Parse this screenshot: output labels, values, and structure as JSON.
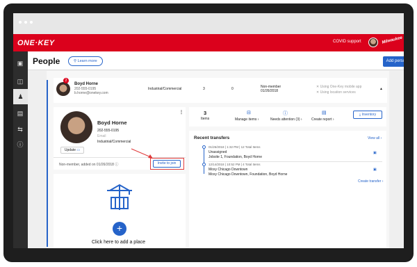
{
  "app": {
    "logo": "ONE·KEY",
    "covid_support": "COVID support",
    "brand": "Milwaukee"
  },
  "sidebar": {
    "icons": [
      "toolbox-icon",
      "map-icon",
      "person-icon",
      "report-icon",
      "transfer-icon",
      "alert-icon"
    ]
  },
  "header": {
    "title": "People",
    "learn_more": "Learn more",
    "add_person": "Add person"
  },
  "person_row": {
    "badge": "2",
    "name": "Boyd Horne",
    "phone": "202-555-0195",
    "email": "b.horne@onekey.com",
    "trade": "Industrial/Commercial",
    "count1": "3",
    "count2": "0",
    "status": "Non-member",
    "status_date": "01/26/2018",
    "app_note": "Using One-Key mobile app",
    "location_note": "Using location services"
  },
  "profile": {
    "name": "Boyd Horne",
    "phone": "202-555-0195",
    "email_placeholder": "Email",
    "trade": "Industrial/Commercial",
    "update_label": "Update",
    "added_text": "Non-member, added on 01/26/2018",
    "invite_label": "Invite to join"
  },
  "place": {
    "add_label": "Click here to add a place"
  },
  "stats": {
    "items_count": "3",
    "items_label": "Items",
    "manage_items": "Manage items",
    "needs_attention": "Needs attention (3)",
    "create_report": "Create report",
    "inventory": "Inventory"
  },
  "transfers": {
    "title": "Recent transfers",
    "view_all": "View all",
    "create": "Create transfer",
    "rows": [
      {
        "meta": "01/26/2018 | 1:32 PM | 12 Total Items",
        "line1": "Unassigned",
        "line2": "Jobsite 1, Foundation, Boyd Horne"
      },
      {
        "meta": "12/14/2018 | 10:52 PM | 4 Total Items",
        "line1": "Moxy Chicago Downtown",
        "line2": "Moxy Chicago Downtown, Foundation, Boyd Horne"
      }
    ]
  },
  "colors": {
    "brand_red": "#db011c",
    "accent_blue": "#2563c9",
    "highlight": "#e03a3a"
  }
}
